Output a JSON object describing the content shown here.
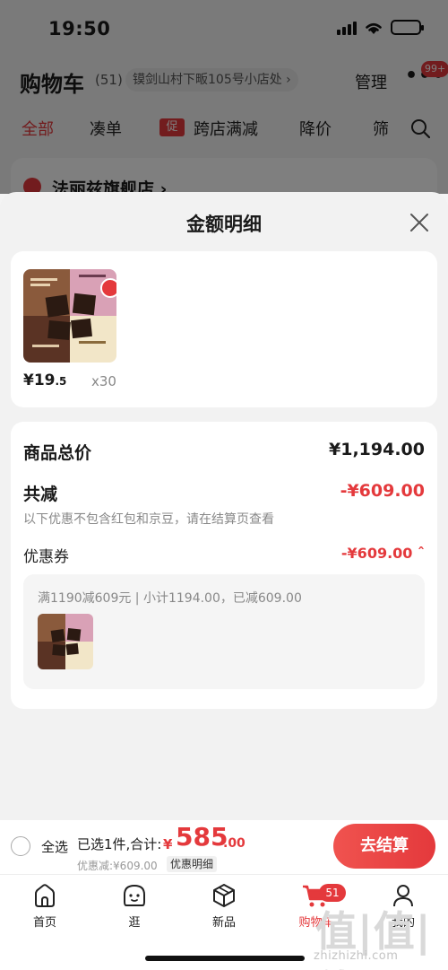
{
  "status_bar": {
    "time": "19:50"
  },
  "cart_header": {
    "title": "购物车",
    "count": "(51)",
    "address": "镆剑山村下畈105号小店处 ›",
    "manage": "管理",
    "more": "•••",
    "badge": "99+"
  },
  "filter_tabs": {
    "all": "全部",
    "bundle": "凑单",
    "promo_tag": "促",
    "cross_store": "跨店满减",
    "price_drop": "降价",
    "filter": "筛"
  },
  "shop": {
    "name": "法丽兹旗舰店 ›"
  },
  "sheet": {
    "title": "金额明细",
    "product": {
      "price_main": "¥19",
      "price_decimal": ".5",
      "quantity": "x30"
    },
    "summary": {
      "total_label": "商品总价",
      "total_value": "¥1,194.00",
      "discount_label": "共减",
      "discount_value": "-¥609.00",
      "note": "以下优惠不包含红包和京豆，请在结算页查看",
      "coupon_label": "优惠券",
      "coupon_value": "-¥609.00 ˆ",
      "coupon_desc": "满1190减609元 | 小计1194.00，已减609.00"
    }
  },
  "checkout": {
    "select_all": "全选",
    "selected": "已选1件,合计:",
    "currency": "¥",
    "total_int": "585",
    "total_dec": ".00",
    "discount_text": "优惠减:¥609.00",
    "detail_link": "优惠明细",
    "button": "去结算"
  },
  "tab_bar": {
    "home": "首页",
    "browse": "逛",
    "new": "新品",
    "cart": "购物车",
    "cart_badge": "51",
    "mine": "我的"
  },
  "watermark": {
    "logo": "值|值|值",
    "text": "zhizhizhi.com"
  },
  "colors": {
    "accent": "#e4393c",
    "background": "#f2f2f2"
  }
}
